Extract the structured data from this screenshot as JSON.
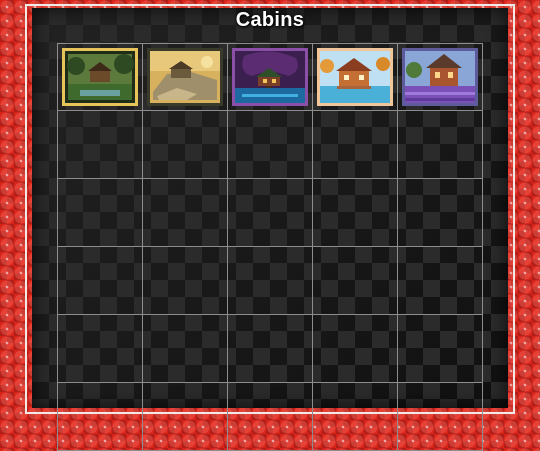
{
  "page": {
    "title": "Cabins"
  },
  "thumbnails": [
    {
      "icon": "cabin-forest-picture",
      "frame": "#e6c35b",
      "sky": "#5b7a3c",
      "ground": "#2d4a22",
      "accent": "#c7b06a"
    },
    {
      "icon": "cabin-rock-sunset-picture",
      "frame": "#3a3a2a",
      "sky": "#d8b15f",
      "ground": "#9f8f6a",
      "accent": "#6c5a3c"
    },
    {
      "icon": "cabin-tree-night-picture",
      "frame": "#8b4fa8",
      "sky": "#3b1f4f",
      "ground": "#1d6aa0",
      "accent": "#7a3f28"
    },
    {
      "icon": "cabin-lake-picture",
      "frame": "#f0c79a",
      "sky": "#bfe0f2",
      "ground": "#4ab0d8",
      "accent": "#c46f33"
    },
    {
      "icon": "cabin-lavender-picture",
      "frame": "#5d5b9b",
      "sky": "#8aa6d6",
      "ground": "#7a4fb8",
      "accent": "#a9552f"
    }
  ],
  "grid": {
    "columns": 5,
    "empty_rows": 5
  }
}
